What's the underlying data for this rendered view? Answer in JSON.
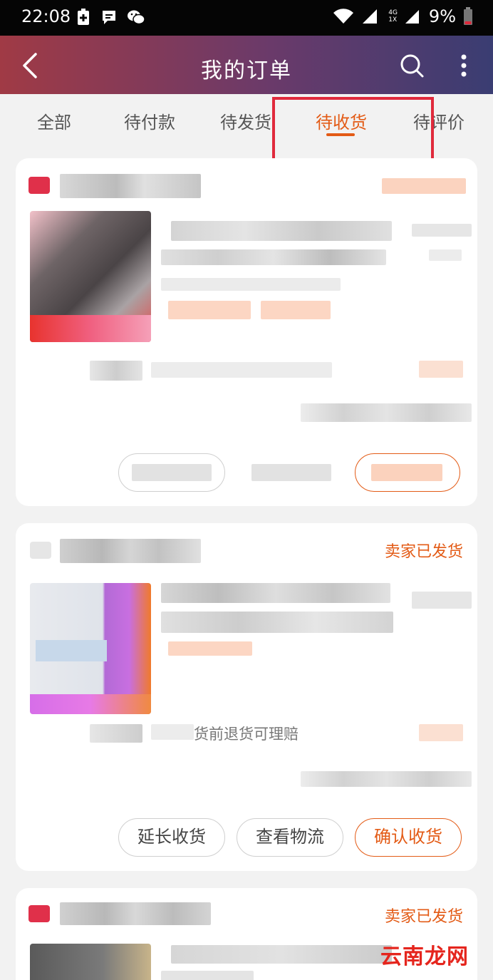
{
  "status_bar": {
    "time": "22:08",
    "signal_label": "4G",
    "battery": "9%",
    "icons": [
      "battery-saver-icon",
      "message-icon",
      "wechat-icon",
      "wifi-icon",
      "signal-icon",
      "battery-icon"
    ]
  },
  "header": {
    "title": "我的订单",
    "back_icon": "back-icon",
    "search_icon": "search-icon",
    "more_icon": "more-icon"
  },
  "tabs": [
    {
      "label": "全部",
      "active": false
    },
    {
      "label": "待付款",
      "active": false
    },
    {
      "label": "待发货",
      "active": false
    },
    {
      "label": "待收货",
      "active": true
    },
    {
      "label": "待评价",
      "active": false
    }
  ],
  "orders": [
    {
      "status": "",
      "buttons": []
    },
    {
      "status": "卖家已发货",
      "promise_text": "货前退货可理赔",
      "buttons": [
        "延长收货",
        "查看物流",
        "确认收货"
      ]
    },
    {
      "status": "卖家已发货",
      "buttons": []
    }
  ],
  "watermark": "云南龙网",
  "colors": {
    "accent": "#e35b16",
    "highlight": "#e02a3c",
    "header_start": "#a03a45",
    "header_end": "#3a3d72"
  }
}
